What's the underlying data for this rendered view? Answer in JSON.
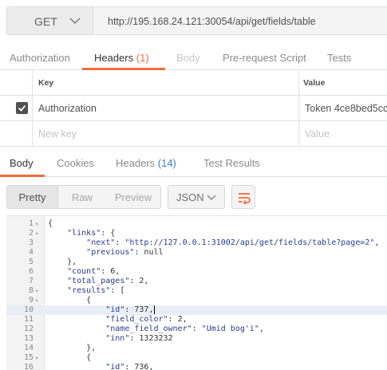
{
  "request": {
    "method": "GET",
    "url": "http://195.168.24.121:30054/api/get/fields/table"
  },
  "request_tabs": [
    {
      "label": "Authorization",
      "state": "normal"
    },
    {
      "label": "Headers",
      "count": "(1)",
      "state": "active"
    },
    {
      "label": "Body",
      "state": "disabled"
    },
    {
      "label": "Pre-request Script",
      "state": "normal"
    },
    {
      "label": "Tests",
      "state": "normal"
    }
  ],
  "headers_table": {
    "key_header": "Key",
    "value_header": "Value",
    "rows": [
      {
        "checked": true,
        "key": "Authorization",
        "value": "Token 4ce8bed5cc"
      }
    ],
    "new_row": {
      "key_placeholder": "New key",
      "value_placeholder": "Value"
    }
  },
  "response_tabs": [
    {
      "label": "Body",
      "state": "active"
    },
    {
      "label": "Cookies",
      "state": "normal"
    },
    {
      "label": "Headers",
      "count": "(14)",
      "state": "normal"
    },
    {
      "label": "Test Results",
      "state": "normal"
    }
  ],
  "view_modes": [
    "Pretty",
    "Raw",
    "Preview"
  ],
  "active_view_mode": "Pretty",
  "format_select": "JSON",
  "icons": {
    "method_dropdown": "chevron-down-icon",
    "checkbox": "check-icon",
    "format_dropdown": "chevron-down-icon",
    "wrap": "wrap-lines-icon"
  },
  "colors": {
    "accent": "#f26b3a",
    "count_blue": "#3a7fd0",
    "json_key": "#2a3a8f"
  },
  "editor": {
    "highlighted_line": 10,
    "lines": [
      {
        "n": "1",
        "fold": "▾",
        "text": "{"
      },
      {
        "n": "2",
        "fold": "▾",
        "text": "    \"links\": {"
      },
      {
        "n": "3",
        "fold": "",
        "text": "        \"next\": \"http://127.0.0.1:31002/api/get/fields/table?page=2\","
      },
      {
        "n": "4",
        "fold": "",
        "text": "        \"previous\": null"
      },
      {
        "n": "5",
        "fold": "",
        "text": "    },"
      },
      {
        "n": "6",
        "fold": "",
        "text": "    \"count\": 6,"
      },
      {
        "n": "7",
        "fold": "",
        "text": "    \"total_pages\": 2,"
      },
      {
        "n": "8",
        "fold": "▾",
        "text": "    \"results\": ["
      },
      {
        "n": "9",
        "fold": "▾",
        "text": "        {"
      },
      {
        "n": "10",
        "fold": "",
        "text": "            \"id\": 737,"
      },
      {
        "n": "11",
        "fold": "",
        "text": "            \"field_color\": 2,"
      },
      {
        "n": "12",
        "fold": "",
        "text": "            \"name_field_owner\": \"Umid bog'i\","
      },
      {
        "n": "13",
        "fold": "",
        "text": "            \"inn\": 1323232"
      },
      {
        "n": "14",
        "fold": "",
        "text": "        },"
      },
      {
        "n": "15",
        "fold": "▾",
        "text": "        {"
      },
      {
        "n": "16",
        "fold": "",
        "text": "            \"id\": 736,"
      }
    ]
  }
}
